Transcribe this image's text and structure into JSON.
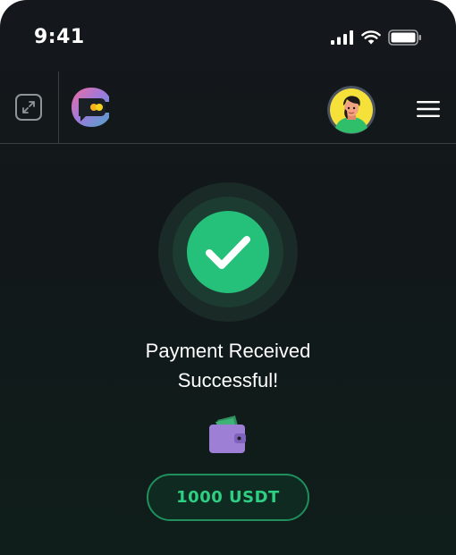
{
  "status_bar": {
    "time": "9:41",
    "icons": [
      "signal-icon",
      "wifi-icon",
      "battery-icon"
    ]
  },
  "header": {
    "icons": [
      "expand-icon",
      "app-logo-icon",
      "avatar",
      "hamburger-menu-icon"
    ]
  },
  "payment": {
    "icon": "checkmark-icon",
    "title_line1": "Payment Received",
    "title_line2": "Successful!",
    "wallet_icon": "wallet-icon",
    "amount": "1000 USDT"
  },
  "colors": {
    "background": "#14171c",
    "success_green": "#25c07a",
    "amount_text": "#2fcf83",
    "wallet_purple": "#9d7fd6"
  }
}
